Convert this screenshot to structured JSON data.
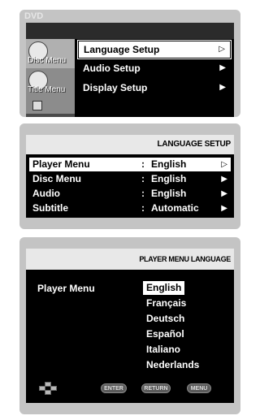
{
  "panel1": {
    "title": "DVD",
    "tabs": [
      {
        "label": "Disc Menu",
        "icon": "disc-icon"
      },
      {
        "label": "Title Menu",
        "icon": "title-icon"
      },
      {
        "label": "",
        "icon": "function-icon"
      }
    ],
    "items": [
      {
        "label": "Language Setup",
        "arrow": "▷",
        "selected": true
      },
      {
        "label": "Audio Setup",
        "arrow": "▶",
        "selected": false
      },
      {
        "label": "Display Setup",
        "arrow": "▶",
        "selected": false
      }
    ]
  },
  "panel2": {
    "header": "LANGUAGE SETUP",
    "rows": [
      {
        "label": "Player Menu",
        "value": "English",
        "arrow": "▷",
        "selected": true
      },
      {
        "label": "Disc Menu",
        "value": "English",
        "arrow": "▶",
        "selected": false
      },
      {
        "label": "Audio",
        "value": "English",
        "arrow": "▶",
        "selected": false
      },
      {
        "label": "Subtitle",
        "value": "Automatic",
        "arrow": "▶",
        "selected": false
      }
    ],
    "colon": ":"
  },
  "panel3": {
    "header": "PLAYER MENU LANGUAGE",
    "label": "Player Menu",
    "options": [
      "English",
      "Français",
      "Deutsch",
      "Español",
      "Italiano",
      "Nederlands"
    ],
    "selected_index": 0,
    "footer": {
      "enter": "ENTER",
      "return": "RETURN",
      "menu": "MENU"
    }
  }
}
